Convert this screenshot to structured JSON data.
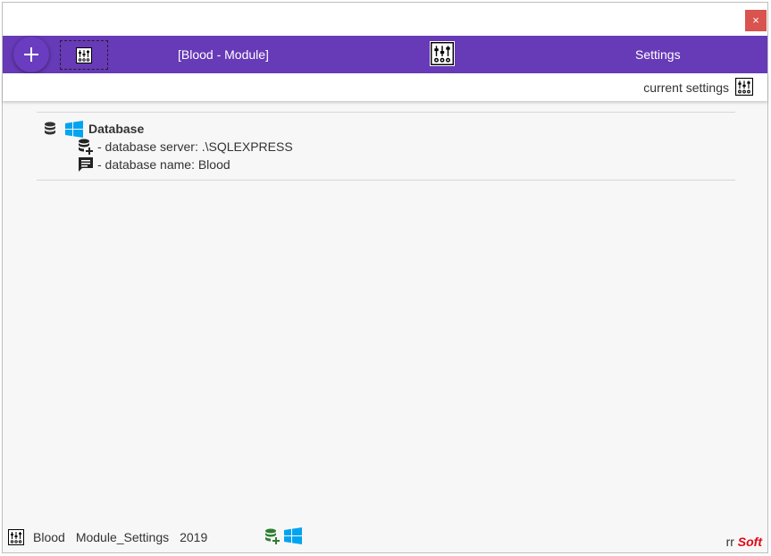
{
  "window": {
    "close_label": "×"
  },
  "toolbar": {
    "add_label": "+",
    "title": "[Blood - Module]",
    "settings_label": "Settings"
  },
  "subbar": {
    "label": "current settings"
  },
  "database": {
    "title": "Database",
    "server_line": "- database server: .\\SQLEXPRESS",
    "name_line": "- database name: Blood"
  },
  "footer": {
    "app": "Blood",
    "module": "Module_Settings",
    "year": "2019"
  },
  "brand": {
    "prefix": "rr",
    "name": "Soft"
  },
  "icons": {
    "settings": "settings-sliders-icon",
    "database": "database-icon",
    "windows": "windows-logo-icon",
    "database_add": "database-plus-icon",
    "comment": "comment-icon"
  },
  "colors": {
    "toolbar": "#673ab7",
    "close": "#d9534f",
    "windows_blue": "#00a4ef",
    "db_green": "#2e7d32",
    "brand_red": "#e30613"
  }
}
